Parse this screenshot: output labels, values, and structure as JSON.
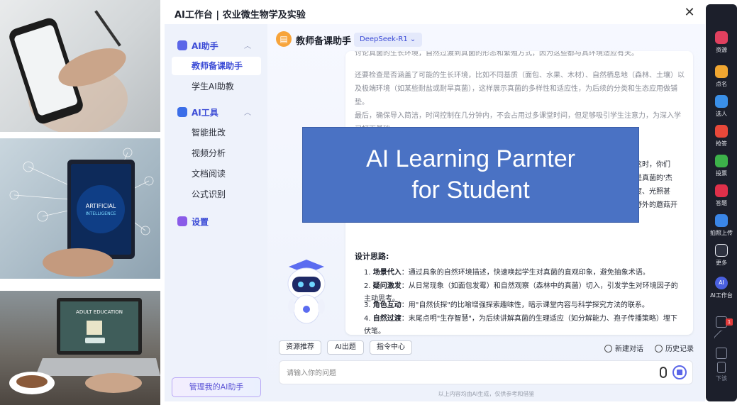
{
  "photos": [
    {
      "name": "photo-phone",
      "caption": ""
    },
    {
      "name": "photo-tablet",
      "caption": "ARTIFICIAL INTELLIGENCE"
    },
    {
      "name": "photo-laptop",
      "caption": "ADULT EDUCATION"
    }
  ],
  "app": {
    "title": "AI工作台 | 农业微生物学及实验",
    "close_glyph": "✕"
  },
  "sidebar": {
    "assistant_section": "AI助手",
    "assistant_items": [
      "教师备课助手",
      "学生AI助教"
    ],
    "tools_section": "AI工具",
    "tools_items": [
      "智能批改",
      "视频分析",
      "文档阅读",
      "公式识别"
    ],
    "settings": "设置",
    "manage_button": "管理我的AI助手"
  },
  "chat": {
    "title": "教师备课助手",
    "model": "DeepSeek-R1 ⌄",
    "paragraphs": [
      "讨论真菌的生长环境，自然过渡到真菌的形态和繁殖方式，因为这些都与其环境适应有关。",
      "还要检查是否涵盖了可能的生长环境，比如不同基质（面包、水果、木材）、自然栖息地（森林、土壤）以及极端环境（如某些耐盐或耐旱真菌），这样展示真菌的多样性和适应性，为后续的分类和生态应用做铺垫。",
      "最后，确保导入简洁，时间控制在几分钟内，不会占用过多课堂时间，但足够吸引学生注意力，为深入学习打下基础。"
    ],
    "fragment_1": "，这时，你们",
    "fragment_2": "都是真菌的'杰",
    "fragment_3": "湿度、光照甚",
    "fragment_4": "朵野外的蘑菇开",
    "design_title": "设计思路:",
    "design_items": [
      {
        "num": "1.",
        "head": "场景代入",
        "text": "：通过具象的自然环境描述，快速唤起学生对真菌的直观印象，避免抽象术语。"
      },
      {
        "num": "2.",
        "head": "疑问激发",
        "text": "：从日常现象（如面包发霉）和自然观察（森林中的真菌）切入，引发学生对环境因子的主动思考。"
      },
      {
        "num": "3.",
        "head": "角色互动",
        "text": "：用\"自然侦探\"的比喻增强探索趣味性，暗示课堂内容与科学探究方法的联系。"
      },
      {
        "num": "4.",
        "head": "自然过渡",
        "text": "：末尾点明\"生存智慧\"，为后续讲解真菌的生理适应（如分解能力、孢子传播策略）埋下伏笔。"
      }
    ],
    "quick_buttons": [
      "资源推荐",
      "AI出题",
      "指令中心"
    ],
    "new_chat": "新建对话",
    "history": "历史记录",
    "input_placeholder": "请输入你的问题",
    "footnote": "以上内容均由AI生成，仅供参考和借鉴"
  },
  "banner": {
    "line1": "AI Learning Parnter",
    "line2": "for Student"
  },
  "right_bar": {
    "items": [
      {
        "label": "资源",
        "color": "#e0405f"
      },
      {
        "label": "点名",
        "color": "#f0a631"
      },
      {
        "label": "选人",
        "color": "#3a8fe8"
      },
      {
        "label": "抢答",
        "color": "#e8483a"
      },
      {
        "label": "投票",
        "color": "#3cb24a"
      },
      {
        "label": "答题",
        "color": "#e0304a"
      },
      {
        "label": "拍照上传",
        "color": "#3a86e8"
      },
      {
        "label": "更多",
        "color": "#2e3240"
      }
    ],
    "ai_label": "AI工作台",
    "ai_icon_text": "AI",
    "badge": "1",
    "bottom_label": "下该"
  }
}
